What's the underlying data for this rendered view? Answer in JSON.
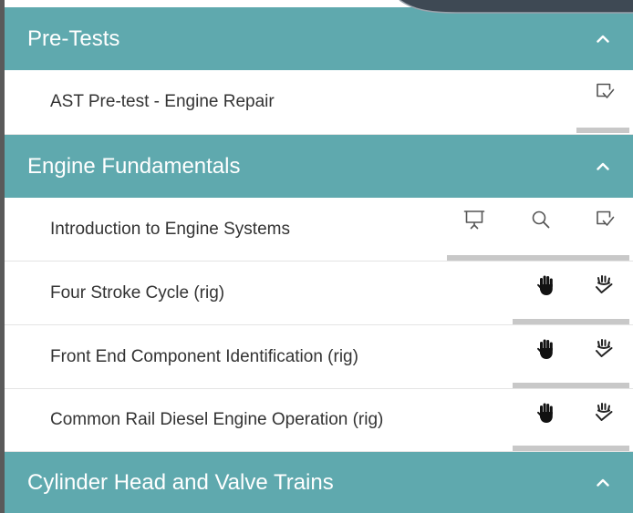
{
  "sections": [
    {
      "title": "Pre-Tests",
      "header_icon": "chevron-up-icon",
      "items": [
        {
          "label": "AST Pre-test - Engine Repair",
          "icons": [
            "check-doc-icon"
          ]
        }
      ]
    },
    {
      "title": "Engine Fundamentals",
      "header_icon": "chevron-up-icon",
      "items": [
        {
          "label": "Introduction to Engine Systems",
          "icons": [
            "presentation-icon",
            "search-icon",
            "check-doc-icon"
          ]
        },
        {
          "label": "Four Stroke Cycle (rig)",
          "icons": [
            "hand-icon",
            "hand-check-icon"
          ]
        },
        {
          "label": "Front End Component Identification (rig)",
          "icons": [
            "hand-icon",
            "hand-check-icon"
          ]
        },
        {
          "label": "Common Rail Diesel Engine Operation (rig)",
          "icons": [
            "hand-icon",
            "hand-check-icon"
          ]
        }
      ]
    },
    {
      "title": "Cylinder Head and Valve Trains",
      "header_icon": "chevron-up-icon",
      "items": []
    }
  ],
  "colors": {
    "section_header_bg": "#5fa9ae",
    "section_header_text": "#ffffff",
    "row_text": "#333333",
    "outline_icon": "#555555",
    "hand_icon": "#111111",
    "underline_bar": "#c8c8c8",
    "top_decoration": "#3e4954"
  }
}
